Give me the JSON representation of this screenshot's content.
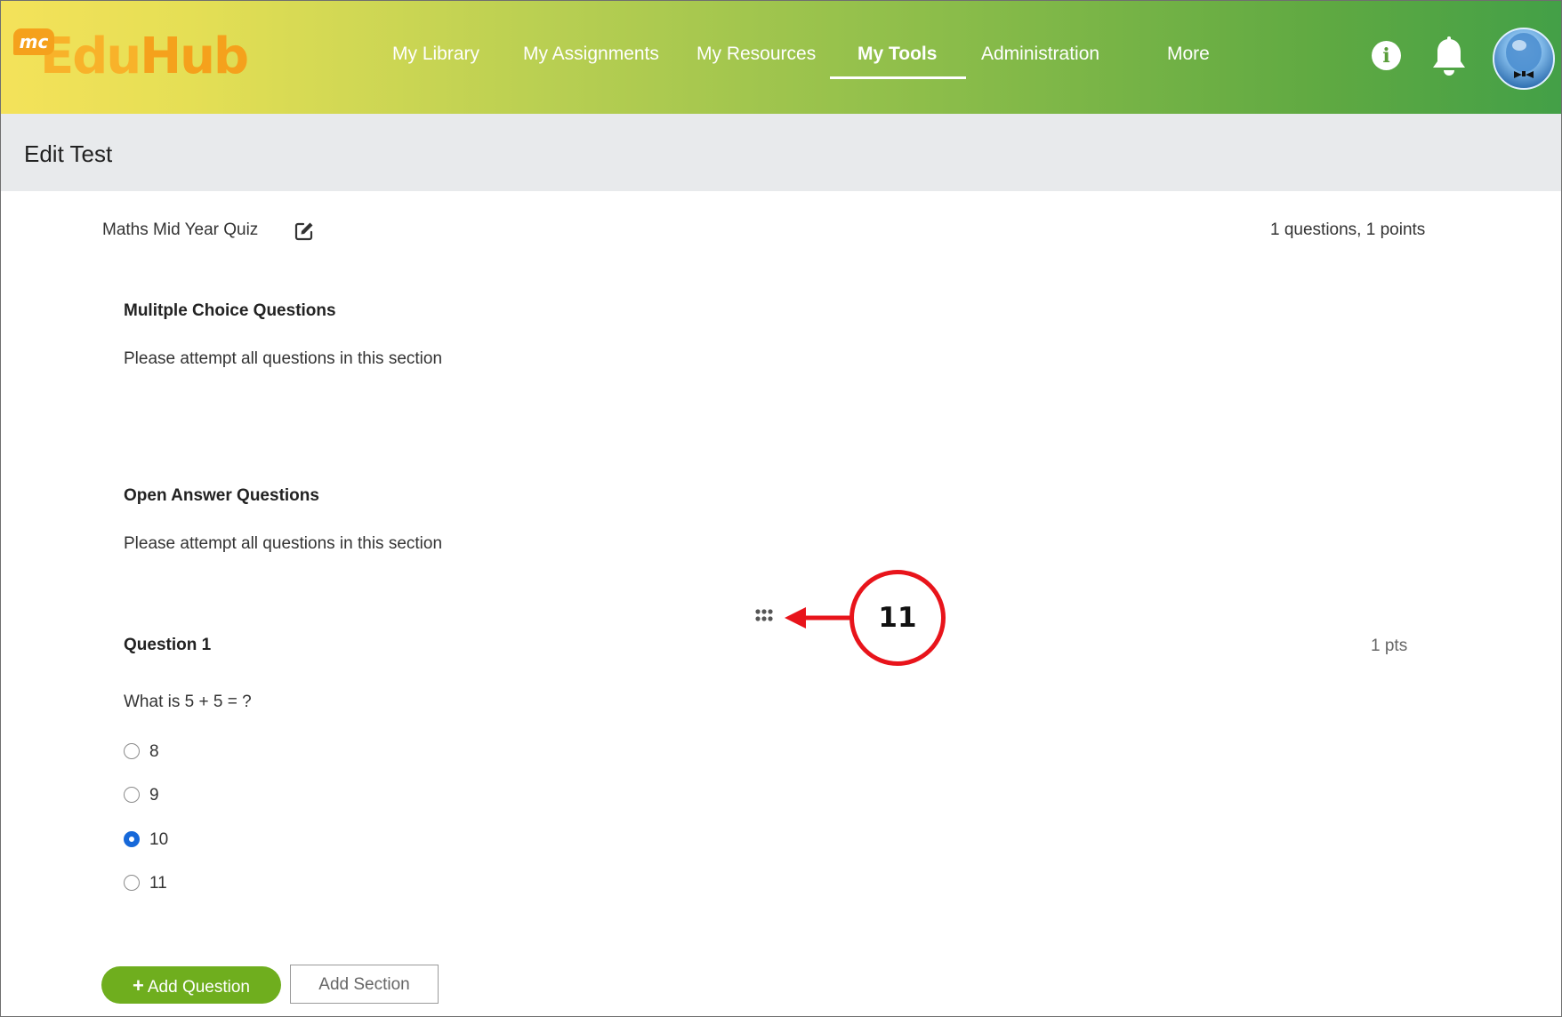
{
  "app": {
    "logo_badge": "mc",
    "logo_text_a": "Edu",
    "logo_text_b": "Hub"
  },
  "nav": {
    "items": [
      {
        "label": "My Library"
      },
      {
        "label": "My Assignments"
      },
      {
        "label": "My Resources"
      },
      {
        "label": "My Tools",
        "active": true
      },
      {
        "label": "Administration"
      },
      {
        "label": "More"
      }
    ],
    "info_icon": "info-icon",
    "bell_icon": "bell-icon",
    "avatar": "user-avatar"
  },
  "page": {
    "title": "Edit Test"
  },
  "test": {
    "name": "Maths Mid Year Quiz",
    "summary": "1 questions, 1 points"
  },
  "sections": [
    {
      "title": "Mulitple Choice Questions",
      "description": "Please attempt all questions in this section"
    },
    {
      "title": "Open Answer Questions",
      "description": "Please attempt all questions in this section"
    }
  ],
  "question": {
    "title": "Question 1",
    "points": "1 pts",
    "text": "What is 5 + 5 = ?",
    "options": [
      {
        "label": "8",
        "selected": false
      },
      {
        "label": "9",
        "selected": false
      },
      {
        "label": "10",
        "selected": true
      },
      {
        "label": "11",
        "selected": false
      }
    ]
  },
  "annotation": {
    "number": "11",
    "color": "#e8141b"
  },
  "actions": {
    "add_question_icon": "+",
    "add_question": "Add Question",
    "add_section": "Add Section"
  },
  "colors": {
    "primary_green": "#6fae1e",
    "radio_selected": "#1668d9",
    "header_gradient_start": "#f4e25a",
    "header_gradient_end": "#43a047"
  }
}
